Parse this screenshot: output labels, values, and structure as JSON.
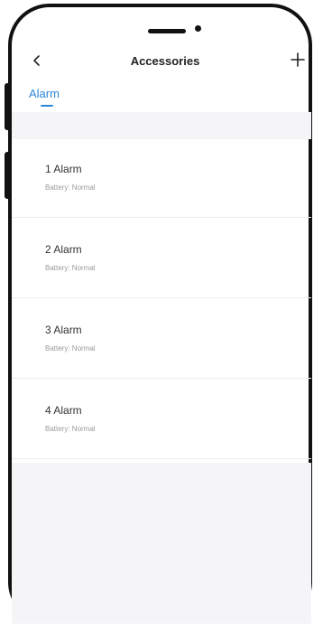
{
  "header": {
    "title": "Accessories"
  },
  "tabs": [
    {
      "label": "Alarm"
    }
  ],
  "items": [
    {
      "name": "1 Alarm",
      "battery": "Battery: Normal"
    },
    {
      "name": "2 Alarm",
      "battery": "Battery: Normal"
    },
    {
      "name": "3 Alarm",
      "battery": "Battery: Normal"
    },
    {
      "name": "4 Alarm",
      "battery": "Battery: Normal"
    }
  ],
  "icons": {
    "back": "chevron-left-icon",
    "add": "plus-icon"
  },
  "colors": {
    "accent": "#2b86d6",
    "background": "#f5f5f7"
  }
}
